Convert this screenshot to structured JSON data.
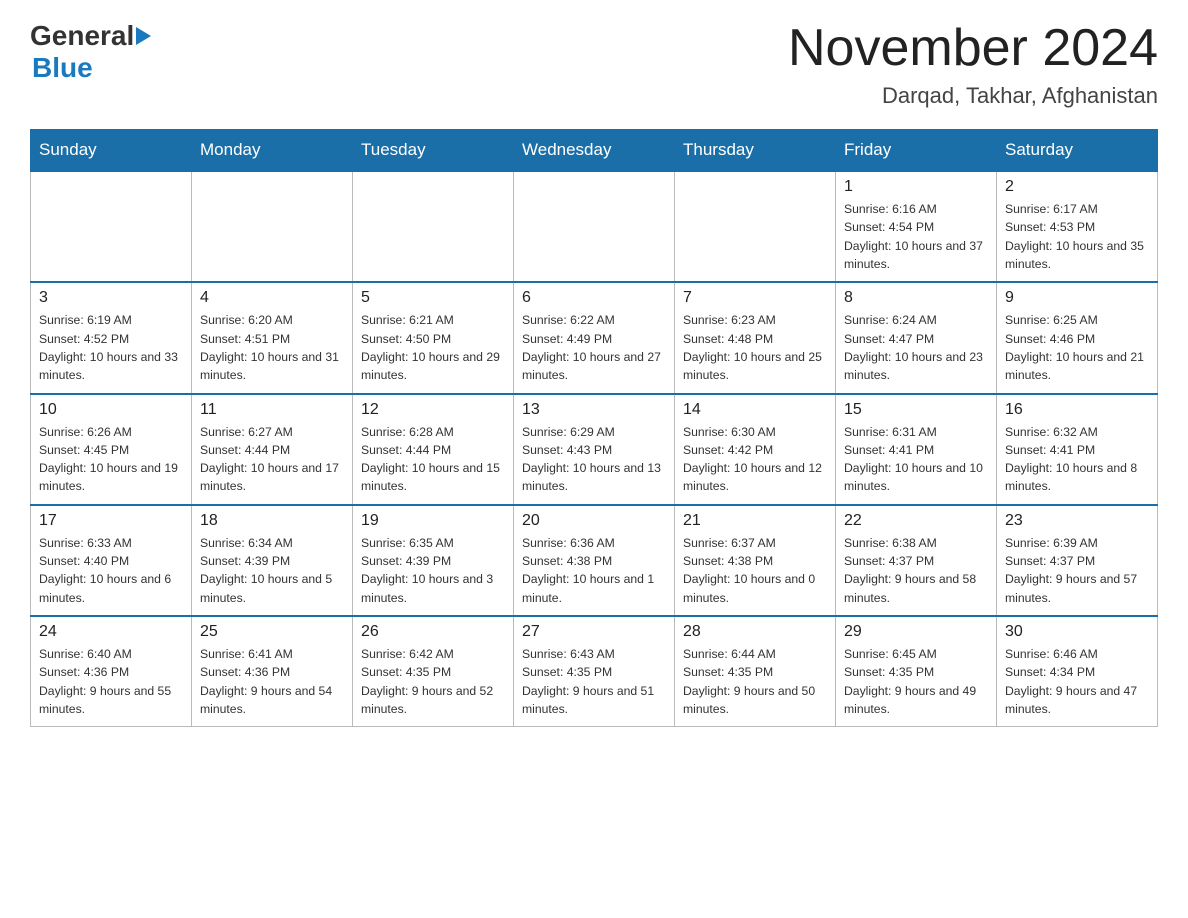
{
  "logo": {
    "general": "General",
    "blue": "Blue"
  },
  "header": {
    "month_year": "November 2024",
    "location": "Darqad, Takhar, Afghanistan"
  },
  "weekdays": [
    "Sunday",
    "Monday",
    "Tuesday",
    "Wednesday",
    "Thursday",
    "Friday",
    "Saturday"
  ],
  "weeks": [
    {
      "days": [
        {
          "number": "",
          "info": ""
        },
        {
          "number": "",
          "info": ""
        },
        {
          "number": "",
          "info": ""
        },
        {
          "number": "",
          "info": ""
        },
        {
          "number": "",
          "info": ""
        },
        {
          "number": "1",
          "info": "Sunrise: 6:16 AM\nSunset: 4:54 PM\nDaylight: 10 hours and 37 minutes."
        },
        {
          "number": "2",
          "info": "Sunrise: 6:17 AM\nSunset: 4:53 PM\nDaylight: 10 hours and 35 minutes."
        }
      ]
    },
    {
      "days": [
        {
          "number": "3",
          "info": "Sunrise: 6:19 AM\nSunset: 4:52 PM\nDaylight: 10 hours and 33 minutes."
        },
        {
          "number": "4",
          "info": "Sunrise: 6:20 AM\nSunset: 4:51 PM\nDaylight: 10 hours and 31 minutes."
        },
        {
          "number": "5",
          "info": "Sunrise: 6:21 AM\nSunset: 4:50 PM\nDaylight: 10 hours and 29 minutes."
        },
        {
          "number": "6",
          "info": "Sunrise: 6:22 AM\nSunset: 4:49 PM\nDaylight: 10 hours and 27 minutes."
        },
        {
          "number": "7",
          "info": "Sunrise: 6:23 AM\nSunset: 4:48 PM\nDaylight: 10 hours and 25 minutes."
        },
        {
          "number": "8",
          "info": "Sunrise: 6:24 AM\nSunset: 4:47 PM\nDaylight: 10 hours and 23 minutes."
        },
        {
          "number": "9",
          "info": "Sunrise: 6:25 AM\nSunset: 4:46 PM\nDaylight: 10 hours and 21 minutes."
        }
      ]
    },
    {
      "days": [
        {
          "number": "10",
          "info": "Sunrise: 6:26 AM\nSunset: 4:45 PM\nDaylight: 10 hours and 19 minutes."
        },
        {
          "number": "11",
          "info": "Sunrise: 6:27 AM\nSunset: 4:44 PM\nDaylight: 10 hours and 17 minutes."
        },
        {
          "number": "12",
          "info": "Sunrise: 6:28 AM\nSunset: 4:44 PM\nDaylight: 10 hours and 15 minutes."
        },
        {
          "number": "13",
          "info": "Sunrise: 6:29 AM\nSunset: 4:43 PM\nDaylight: 10 hours and 13 minutes."
        },
        {
          "number": "14",
          "info": "Sunrise: 6:30 AM\nSunset: 4:42 PM\nDaylight: 10 hours and 12 minutes."
        },
        {
          "number": "15",
          "info": "Sunrise: 6:31 AM\nSunset: 4:41 PM\nDaylight: 10 hours and 10 minutes."
        },
        {
          "number": "16",
          "info": "Sunrise: 6:32 AM\nSunset: 4:41 PM\nDaylight: 10 hours and 8 minutes."
        }
      ]
    },
    {
      "days": [
        {
          "number": "17",
          "info": "Sunrise: 6:33 AM\nSunset: 4:40 PM\nDaylight: 10 hours and 6 minutes."
        },
        {
          "number": "18",
          "info": "Sunrise: 6:34 AM\nSunset: 4:39 PM\nDaylight: 10 hours and 5 minutes."
        },
        {
          "number": "19",
          "info": "Sunrise: 6:35 AM\nSunset: 4:39 PM\nDaylight: 10 hours and 3 minutes."
        },
        {
          "number": "20",
          "info": "Sunrise: 6:36 AM\nSunset: 4:38 PM\nDaylight: 10 hours and 1 minute."
        },
        {
          "number": "21",
          "info": "Sunrise: 6:37 AM\nSunset: 4:38 PM\nDaylight: 10 hours and 0 minutes."
        },
        {
          "number": "22",
          "info": "Sunrise: 6:38 AM\nSunset: 4:37 PM\nDaylight: 9 hours and 58 minutes."
        },
        {
          "number": "23",
          "info": "Sunrise: 6:39 AM\nSunset: 4:37 PM\nDaylight: 9 hours and 57 minutes."
        }
      ]
    },
    {
      "days": [
        {
          "number": "24",
          "info": "Sunrise: 6:40 AM\nSunset: 4:36 PM\nDaylight: 9 hours and 55 minutes."
        },
        {
          "number": "25",
          "info": "Sunrise: 6:41 AM\nSunset: 4:36 PM\nDaylight: 9 hours and 54 minutes."
        },
        {
          "number": "26",
          "info": "Sunrise: 6:42 AM\nSunset: 4:35 PM\nDaylight: 9 hours and 52 minutes."
        },
        {
          "number": "27",
          "info": "Sunrise: 6:43 AM\nSunset: 4:35 PM\nDaylight: 9 hours and 51 minutes."
        },
        {
          "number": "28",
          "info": "Sunrise: 6:44 AM\nSunset: 4:35 PM\nDaylight: 9 hours and 50 minutes."
        },
        {
          "number": "29",
          "info": "Sunrise: 6:45 AM\nSunset: 4:35 PM\nDaylight: 9 hours and 49 minutes."
        },
        {
          "number": "30",
          "info": "Sunrise: 6:46 AM\nSunset: 4:34 PM\nDaylight: 9 hours and 47 minutes."
        }
      ]
    }
  ]
}
